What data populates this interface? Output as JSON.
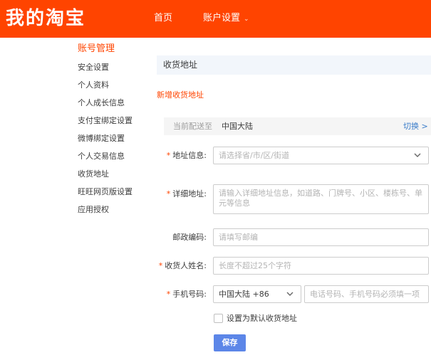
{
  "header": {
    "logo": "我的淘宝",
    "nav": {
      "home": "首页",
      "account_settings": "账户设置",
      "caret": "⌄"
    }
  },
  "sidebar": {
    "title": "账号管理",
    "items": [
      {
        "label": "安全设置"
      },
      {
        "label": "个人资料"
      },
      {
        "label": "个人成长信息"
      },
      {
        "label": "支付宝绑定设置"
      },
      {
        "label": "微博绑定设置"
      },
      {
        "label": "个人交易信息"
      },
      {
        "label": "收货地址"
      },
      {
        "label": "旺旺网页版设置"
      },
      {
        "label": "应用授权"
      }
    ]
  },
  "main": {
    "section_title": "收货地址",
    "new_address_link": "新增收货地址",
    "delivery": {
      "label": "当前配送至",
      "value": "中国大陆",
      "switch": "切换 >"
    },
    "form": {
      "required_mark": "*",
      "address": {
        "label": "地址信息:",
        "placeholder": "请选择省/市/区/街道"
      },
      "detail": {
        "label": "详细地址:",
        "placeholder": "请输入详细地址信息，如道路、门牌号、小区、楼栋号、单元等信息"
      },
      "postal": {
        "label": "邮政编码:",
        "placeholder": "请填写邮编"
      },
      "recipient": {
        "label": "收货人姓名:",
        "placeholder": "长度不超过25个字符"
      },
      "phone": {
        "label": "手机号码:",
        "region_value": "中国大陆 +86",
        "placeholder": "电话号码、手机号码必须填一项"
      },
      "default_checkbox": {
        "label": "设置为默认收货地址",
        "checked": false
      },
      "save_button": "保存"
    }
  },
  "colors": {
    "brand": "#ff4400",
    "link": "#3a7cc9",
    "button": "#5c86e8",
    "section_bg": "#f2f6fb"
  }
}
